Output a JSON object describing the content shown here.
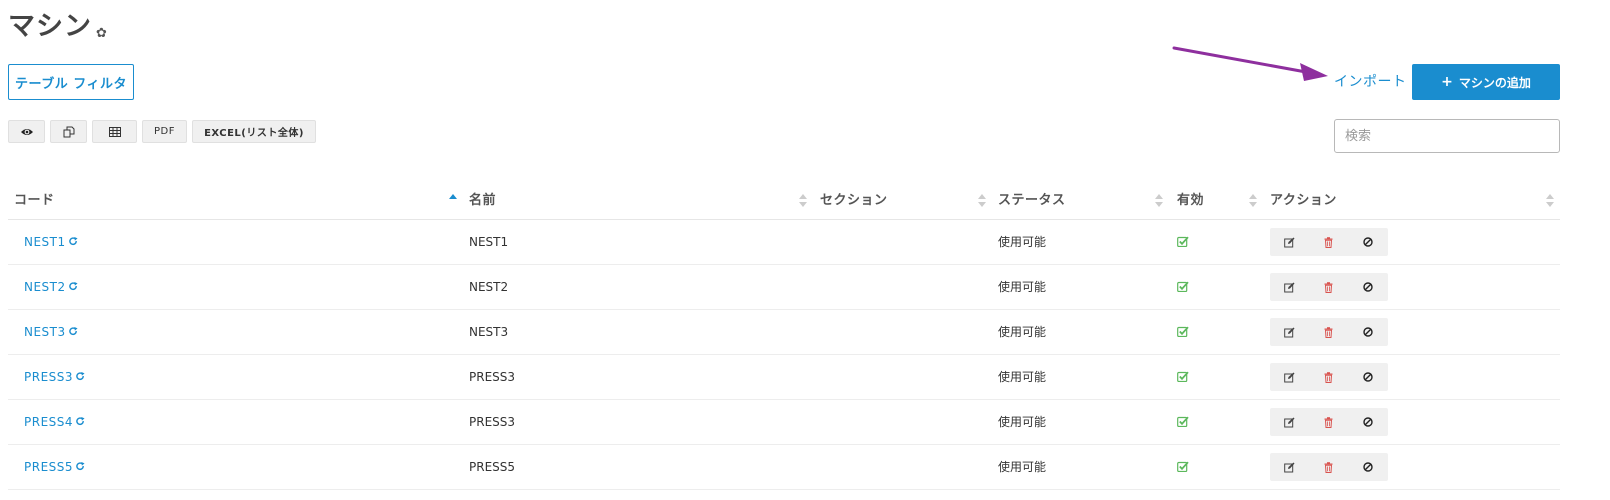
{
  "page": {
    "title": "マシン"
  },
  "toolbar": {
    "filter_label": "テーブル フィルタ",
    "import_label": "インポート",
    "add_label": "マシンの追加"
  },
  "export": {
    "pdf_label": "PDF",
    "excel_label": "EXCEL(リスト全体)"
  },
  "search": {
    "placeholder": "検索"
  },
  "table": {
    "columns": [
      "コード",
      "名前",
      "セクション",
      "ステータス",
      "有効",
      "アクション"
    ],
    "sort_column": "コード",
    "sort_direction": "asc",
    "rows": [
      {
        "code": "NEST1",
        "name": "NEST1",
        "section": "",
        "status": "使用可能",
        "active": true
      },
      {
        "code": "NEST2",
        "name": "NEST2",
        "section": "",
        "status": "使用可能",
        "active": true
      },
      {
        "code": "NEST3",
        "name": "NEST3",
        "section": "",
        "status": "使用可能",
        "active": true
      },
      {
        "code": "PRESS3",
        "name": "PRESS3",
        "section": "",
        "status": "使用可能",
        "active": true
      },
      {
        "code": "PRESS4",
        "name": "PRESS3",
        "section": "",
        "status": "使用可能",
        "active": true
      },
      {
        "code": "PRESS5",
        "name": "PRESS5",
        "section": "",
        "status": "使用可能",
        "active": true
      }
    ]
  },
  "icons": {
    "title": "gear-icon",
    "add": "plus-icon",
    "export": [
      "eye-icon",
      "copy-icon",
      "table-icon"
    ],
    "row_code": "refresh-icon",
    "row_active": "check-square-icon",
    "row_actions": [
      "edit-icon",
      "trash-icon",
      "ban-icon"
    ]
  },
  "colors": {
    "accent": "#1a8dcf",
    "success": "#5cb85c",
    "danger": "#d9534f",
    "annotation_arrow": "#8e2f9e"
  }
}
